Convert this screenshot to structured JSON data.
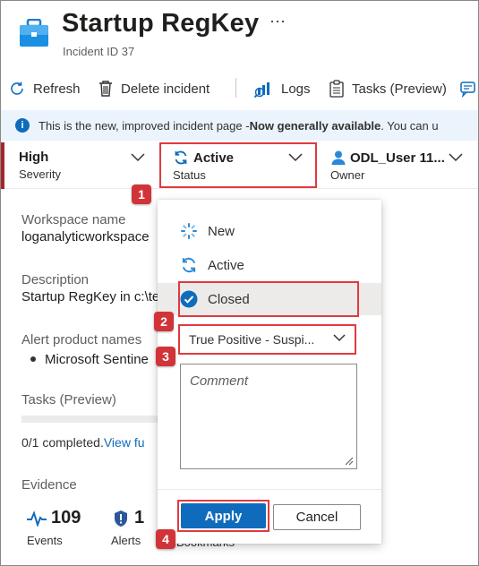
{
  "header": {
    "title": "Startup RegKey",
    "subtitle": "Incident ID 37",
    "more": "···"
  },
  "toolbar": {
    "refresh": "Refresh",
    "delete": "Delete incident",
    "logs": "Logs",
    "tasks": "Tasks (Preview)"
  },
  "banner": {
    "prefix": "This is the new, improved incident page - ",
    "bold": "Now generally available",
    "suffix": ". You can u"
  },
  "status_row": {
    "severity_value": "High",
    "severity_label": "Severity",
    "status_value": "Active",
    "status_label": "Status",
    "owner_value": "ODL_User 11...",
    "owner_label": "Owner"
  },
  "details": {
    "workspace_label": "Workspace name",
    "workspace_value": "loganalyticworkspace",
    "description_label": "Description",
    "description_value": "Startup RegKey in c:\\te",
    "alert_products_label": "Alert product names",
    "alert_product_item": "Microsoft Sentine",
    "tasks_label": "Tasks (Preview)",
    "tasks_completed": "0/1 completed.",
    "tasks_link": "View fu",
    "tasks_progress": 0,
    "evidence_label": "Evidence"
  },
  "evidence": {
    "events_count": "109",
    "events_label": "Events",
    "alerts_count": "1",
    "alerts_label": "Alerts",
    "bookmarks_label": "Bookmarks"
  },
  "status_dropdown": {
    "options": [
      {
        "label": "New"
      },
      {
        "label": "Active"
      },
      {
        "label": "Closed"
      }
    ],
    "selected": "Closed",
    "classification": "True Positive - Suspi...",
    "comment_placeholder": "Comment",
    "apply_label": "Apply",
    "cancel_label": "Cancel"
  },
  "callouts": [
    "1",
    "2",
    "3",
    "4"
  ],
  "colors": {
    "accent": "#0f6cbd",
    "highlight": "#e03a3e",
    "severity_high": "#a4262c",
    "banner_bg": "#ebf3fc"
  }
}
